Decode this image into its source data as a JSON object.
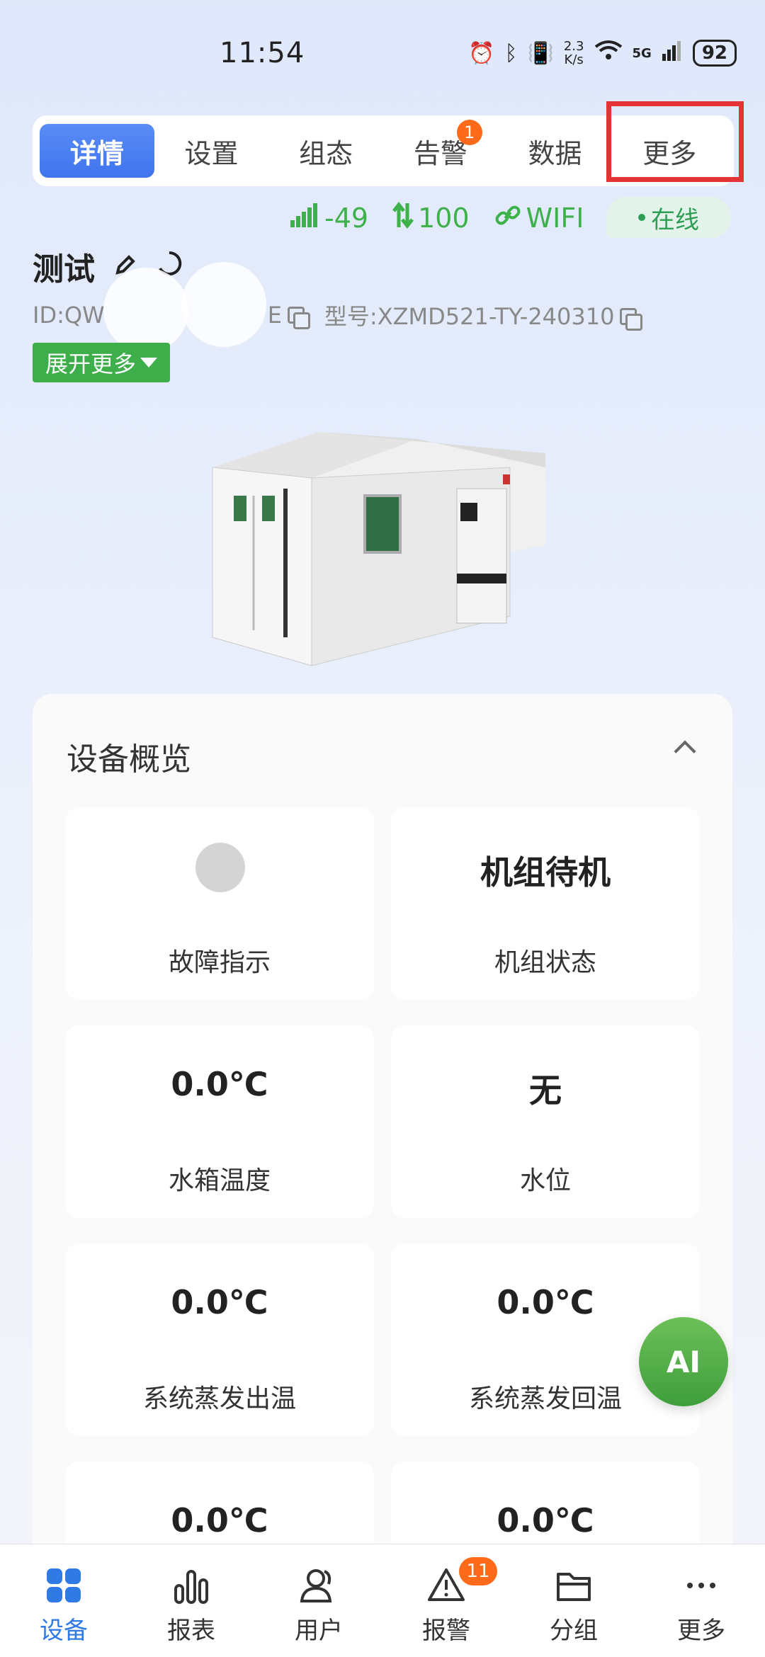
{
  "status_bar": {
    "time": "11:54",
    "net_speed_value": "2.3",
    "net_speed_unit": "K/s",
    "network": "5G",
    "battery": "92"
  },
  "tabs": [
    {
      "label": "详情",
      "active": true
    },
    {
      "label": "设置",
      "active": false
    },
    {
      "label": "组态",
      "active": false
    },
    {
      "label": "告警",
      "active": false,
      "badge": "1"
    },
    {
      "label": "数据",
      "active": false
    },
    {
      "label": "更多",
      "active": false
    }
  ],
  "signal": {
    "rssi": "-49",
    "quality": "100",
    "connection": "WIFI",
    "online": "在线"
  },
  "device": {
    "name": "测试",
    "id_text": "ID:QW",
    "id_suffix": "E",
    "model_text": "型号:XZMD521-TY-240310",
    "expand_label": "展开更多"
  },
  "overview": {
    "title": "设备概览",
    "tiles": [
      {
        "value": "",
        "label": "故障指示"
      },
      {
        "value": "机组待机",
        "label": "机组状态"
      },
      {
        "value": "0.0℃",
        "label": "水箱温度"
      },
      {
        "value": "无",
        "label": "水位"
      },
      {
        "value": "0.0℃",
        "label": "系统蒸发出温"
      },
      {
        "value": "0.0℃",
        "label": "系统蒸发回温"
      },
      {
        "value": "0.0℃",
        "label": ""
      },
      {
        "value": "0.0℃",
        "label": ""
      }
    ]
  },
  "ai_label": "AI",
  "bottom_nav": [
    {
      "label": "设备",
      "active": true
    },
    {
      "label": "报表",
      "active": false
    },
    {
      "label": "用户",
      "active": false
    },
    {
      "label": "报警",
      "active": false,
      "badge": "11"
    },
    {
      "label": "分组",
      "active": false
    },
    {
      "label": "更多",
      "active": false
    }
  ],
  "colors": {
    "accent": "#3f74ee",
    "green": "#3db14a",
    "badge": "#ff6a1a",
    "highlight": "#e53232"
  }
}
